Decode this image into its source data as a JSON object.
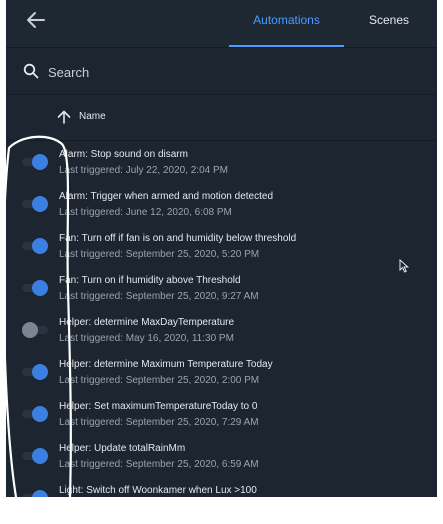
{
  "header": {
    "back_icon": "arrow-left-icon",
    "tabs": [
      {
        "label": "Automations",
        "active": true
      },
      {
        "label": "Scenes",
        "active": false
      }
    ]
  },
  "search": {
    "icon": "search-icon",
    "placeholder": "Search",
    "value": ""
  },
  "sort": {
    "icon": "arrow-up-icon",
    "label": "Name"
  },
  "automations": [
    {
      "name": "Alarm: Stop sound on disarm",
      "last_triggered": "Last triggered: July 22, 2020, 2:04 PM",
      "enabled": true
    },
    {
      "name": "Alarm: Trigger when armed and motion detected",
      "last_triggered": "Last triggered: June 12, 2020, 6:08 PM",
      "enabled": true
    },
    {
      "name": "Fan: Turn off if fan is on and humidity below threshold",
      "last_triggered": "Last triggered: September 25, 2020, 5:20 PM",
      "enabled": true
    },
    {
      "name": "Fan: Turn on if humidity above Threshold",
      "last_triggered": "Last triggered: September 25, 2020, 9:27 AM",
      "enabled": true
    },
    {
      "name": "Helper: determine MaxDayTemperature",
      "last_triggered": "Last triggered: May 16, 2020, 11:30 PM",
      "enabled": false
    },
    {
      "name": "Helper: determine Maximum Temperature Today",
      "last_triggered": "Last triggered: September 25, 2020, 2:00 PM",
      "enabled": true
    },
    {
      "name": "Helper: Set maximumTemperatureToday to 0",
      "last_triggered": "Last triggered: September 25, 2020, 7:29 AM",
      "enabled": true
    },
    {
      "name": "Helper: Update totalRainMm",
      "last_triggered": "Last triggered: September 25, 2020, 6:59 AM",
      "enabled": true
    },
    {
      "name": "Light: Switch off Woonkamer when Lux >100",
      "last_triggered": "",
      "enabled": true
    }
  ],
  "colors": {
    "background": "#1c2530",
    "accent": "#4a9cff",
    "toggle_on": "#3b7fe0",
    "toggle_off": "#7c8693"
  }
}
